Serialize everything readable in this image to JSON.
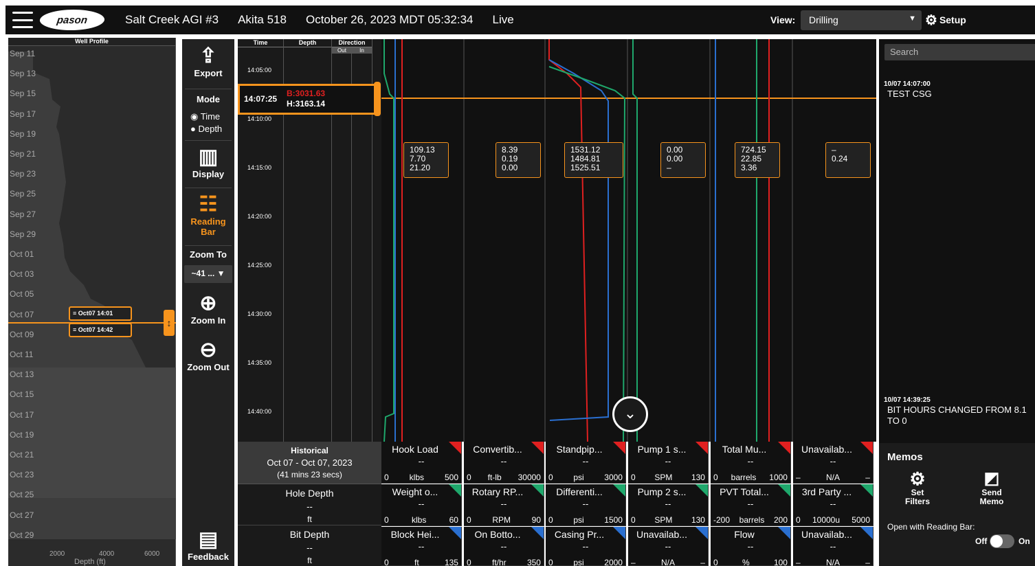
{
  "topbar": {
    "logo": "pason",
    "well": "Salt Creek AGI #3",
    "rig": "Akita 518",
    "datetime": "October 26, 2023 MDT 05:32:34",
    "mode": "Live",
    "view_label": "View:",
    "view_value": "Drilling",
    "setup": "Setup"
  },
  "well_profile": {
    "title": "Well Profile",
    "dates": [
      "Sep 11",
      "Sep 13",
      "Sep 15",
      "Sep 17",
      "Sep 19",
      "Sep 21",
      "Sep 23",
      "Sep 25",
      "Sep 27",
      "Sep 29",
      "Oct 01",
      "Oct 03",
      "Oct 05",
      "Oct 07",
      "Oct 09",
      "Oct 11",
      "Oct 13",
      "Oct 15",
      "Oct 17",
      "Oct 19",
      "Oct 21",
      "Oct 23",
      "Oct 25",
      "Oct 27",
      "Oct 29"
    ],
    "x_ticks": [
      "2000",
      "4000",
      "6000"
    ],
    "xlabel": "Depth (ft)",
    "marker_start": "Oct07 14:01",
    "marker_end": "Oct07 14:42"
  },
  "toolbar": {
    "export": "Export",
    "mode": "Mode",
    "time": "Time",
    "depth": "Depth",
    "display": "Display",
    "reading_bar": "Reading Bar",
    "zoom_to": "Zoom To",
    "zoom_value": "~41 ...",
    "zoom_in": "Zoom In",
    "zoom_out": "Zoom Out",
    "feedback": "Feedback"
  },
  "time_depth": {
    "col_time": "Time",
    "col_depth": "Depth",
    "col_direction": "Direction",
    "dir_out": "Out",
    "dir_in": "In",
    "times": [
      "14:05:00",
      "14:10:00",
      "14:15:00",
      "14:20:00",
      "14:25:00",
      "14:30:00",
      "14:35:00",
      "14:40:00"
    ],
    "reading_time": "14:07:25",
    "bit_depth": "B:3031.63",
    "hole_depth": "H:3163.14"
  },
  "readouts": [
    [
      "109.13",
      "7.70",
      "21.20"
    ],
    [
      "8.39",
      "0.19",
      "0.00"
    ],
    [
      "1531.12",
      "1484.81",
      "1525.51"
    ],
    [
      "0.00",
      "0.00",
      "–"
    ],
    [
      "724.15",
      "22.85",
      "3.36"
    ],
    [
      "–",
      "0.24"
    ]
  ],
  "historical": {
    "title": "Historical",
    "range": "Oct 07 - Oct 07, 2023",
    "duration": "(41 mins 23 secs)",
    "hole_depth": "Hole Depth",
    "bit_depth": "Bit Depth",
    "unit": "ft",
    "dash": "--"
  },
  "channels": [
    [
      {
        "name": "Hook Load",
        "unit": "klbs",
        "min": "0",
        "max": "500",
        "color": "#e02020"
      },
      {
        "name": "Weight o...",
        "unit": "klbs",
        "min": "0",
        "max": "60",
        "color": "#1fa86c"
      },
      {
        "name": "Block Hei...",
        "unit": "ft",
        "min": "0",
        "max": "135",
        "color": "#2a6fd0"
      }
    ],
    [
      {
        "name": "Convertib...",
        "unit": "ft-lb",
        "min": "0",
        "max": "30000",
        "color": "#e02020"
      },
      {
        "name": "Rotary RP...",
        "unit": "RPM",
        "min": "0",
        "max": "90",
        "color": "#1fa86c"
      },
      {
        "name": "On Botto...",
        "unit": "ft/hr",
        "min": "0",
        "max": "350",
        "color": "#2a6fd0"
      }
    ],
    [
      {
        "name": "Standpip...",
        "unit": "psi",
        "min": "0",
        "max": "3000",
        "color": "#e02020"
      },
      {
        "name": "Differenti...",
        "unit": "psi",
        "min": "0",
        "max": "1500",
        "color": "#1fa86c"
      },
      {
        "name": "Casing Pr...",
        "unit": "psi",
        "min": "0",
        "max": "2000",
        "color": "#2a6fd0"
      }
    ],
    [
      {
        "name": "Pump 1 s...",
        "unit": "SPM",
        "min": "0",
        "max": "130",
        "color": "#e02020"
      },
      {
        "name": "Pump 2 s...",
        "unit": "SPM",
        "min": "0",
        "max": "130",
        "color": "#1fa86c"
      },
      {
        "name": "Unavailab...",
        "unit": "N/A",
        "min": "–",
        "max": "–",
        "color": "#2a6fd0"
      }
    ],
    [
      {
        "name": "Total Mu...",
        "unit": "barrels",
        "min": "0",
        "max": "1000",
        "color": "#e02020"
      },
      {
        "name": "PVT Total...",
        "unit": "barrels",
        "min": "-200",
        "max": "200",
        "color": "#1fa86c"
      },
      {
        "name": "Flow",
        "unit": "%",
        "min": "0",
        "max": "100",
        "color": "#2a6fd0"
      }
    ],
    [
      {
        "name": "Unavailab...",
        "unit": "N/A",
        "min": "–",
        "max": "–",
        "color": "#e02020"
      },
      {
        "name": "3rd Party ...",
        "unit": "10000u",
        "min": "0",
        "max": "5000",
        "color": "#1fa86c"
      },
      {
        "name": "Unavailab...",
        "unit": "N/A",
        "min": "–",
        "max": "–",
        "color": "#2a6fd0"
      }
    ]
  ],
  "right_panel": {
    "search_placeholder": "Search",
    "memo1_time": "10/07 14:07:00",
    "memo1_text": "TEST CSG",
    "memo2_time": "10/07 14:39:25",
    "memo2_text": "BIT HOURS CHANGED FROM 8.1 TO 0",
    "memos_title": "Memos",
    "set_filters": "Set Filters",
    "send_memo": "Send Memo",
    "open_with": "Open with Reading Bar:",
    "off": "Off",
    "on": "On"
  },
  "colors": {
    "accent": "#f7941d",
    "red": "#e02020",
    "green": "#1fa86c",
    "blue": "#2a6fd0"
  }
}
